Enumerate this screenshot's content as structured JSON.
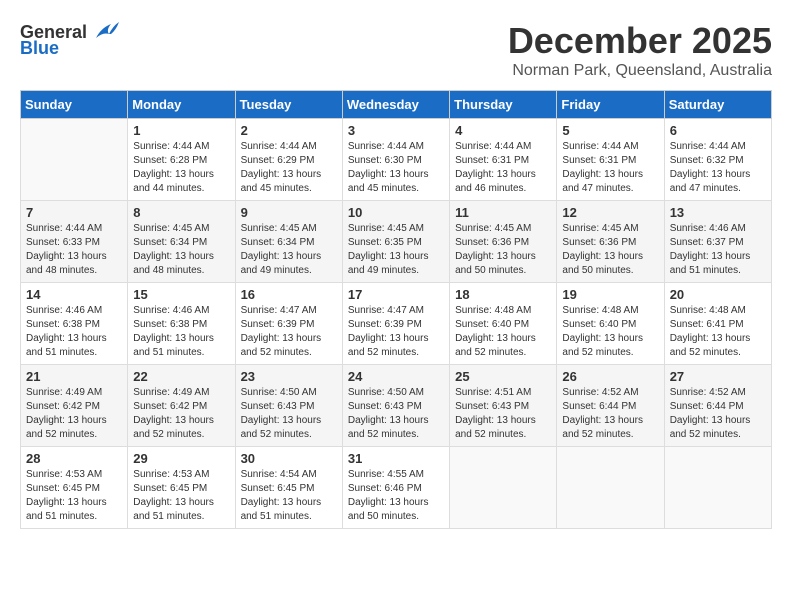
{
  "header": {
    "logo_general": "General",
    "logo_blue": "Blue",
    "month_title": "December 2025",
    "location": "Norman Park, Queensland, Australia"
  },
  "days_of_week": [
    "Sunday",
    "Monday",
    "Tuesday",
    "Wednesday",
    "Thursday",
    "Friday",
    "Saturday"
  ],
  "weeks": [
    [
      {
        "day": "",
        "sunrise": "",
        "sunset": "",
        "daylight": ""
      },
      {
        "day": "1",
        "sunrise": "Sunrise: 4:44 AM",
        "sunset": "Sunset: 6:28 PM",
        "daylight": "Daylight: 13 hours and 44 minutes."
      },
      {
        "day": "2",
        "sunrise": "Sunrise: 4:44 AM",
        "sunset": "Sunset: 6:29 PM",
        "daylight": "Daylight: 13 hours and 45 minutes."
      },
      {
        "day": "3",
        "sunrise": "Sunrise: 4:44 AM",
        "sunset": "Sunset: 6:30 PM",
        "daylight": "Daylight: 13 hours and 45 minutes."
      },
      {
        "day": "4",
        "sunrise": "Sunrise: 4:44 AM",
        "sunset": "Sunset: 6:31 PM",
        "daylight": "Daylight: 13 hours and 46 minutes."
      },
      {
        "day": "5",
        "sunrise": "Sunrise: 4:44 AM",
        "sunset": "Sunset: 6:31 PM",
        "daylight": "Daylight: 13 hours and 47 minutes."
      },
      {
        "day": "6",
        "sunrise": "Sunrise: 4:44 AM",
        "sunset": "Sunset: 6:32 PM",
        "daylight": "Daylight: 13 hours and 47 minutes."
      }
    ],
    [
      {
        "day": "7",
        "sunrise": "Sunrise: 4:44 AM",
        "sunset": "Sunset: 6:33 PM",
        "daylight": "Daylight: 13 hours and 48 minutes."
      },
      {
        "day": "8",
        "sunrise": "Sunrise: 4:45 AM",
        "sunset": "Sunset: 6:34 PM",
        "daylight": "Daylight: 13 hours and 48 minutes."
      },
      {
        "day": "9",
        "sunrise": "Sunrise: 4:45 AM",
        "sunset": "Sunset: 6:34 PM",
        "daylight": "Daylight: 13 hours and 49 minutes."
      },
      {
        "day": "10",
        "sunrise": "Sunrise: 4:45 AM",
        "sunset": "Sunset: 6:35 PM",
        "daylight": "Daylight: 13 hours and 49 minutes."
      },
      {
        "day": "11",
        "sunrise": "Sunrise: 4:45 AM",
        "sunset": "Sunset: 6:36 PM",
        "daylight": "Daylight: 13 hours and 50 minutes."
      },
      {
        "day": "12",
        "sunrise": "Sunrise: 4:45 AM",
        "sunset": "Sunset: 6:36 PM",
        "daylight": "Daylight: 13 hours and 50 minutes."
      },
      {
        "day": "13",
        "sunrise": "Sunrise: 4:46 AM",
        "sunset": "Sunset: 6:37 PM",
        "daylight": "Daylight: 13 hours and 51 minutes."
      }
    ],
    [
      {
        "day": "14",
        "sunrise": "Sunrise: 4:46 AM",
        "sunset": "Sunset: 6:38 PM",
        "daylight": "Daylight: 13 hours and 51 minutes."
      },
      {
        "day": "15",
        "sunrise": "Sunrise: 4:46 AM",
        "sunset": "Sunset: 6:38 PM",
        "daylight": "Daylight: 13 hours and 51 minutes."
      },
      {
        "day": "16",
        "sunrise": "Sunrise: 4:47 AM",
        "sunset": "Sunset: 6:39 PM",
        "daylight": "Daylight: 13 hours and 52 minutes."
      },
      {
        "day": "17",
        "sunrise": "Sunrise: 4:47 AM",
        "sunset": "Sunset: 6:39 PM",
        "daylight": "Daylight: 13 hours and 52 minutes."
      },
      {
        "day": "18",
        "sunrise": "Sunrise: 4:48 AM",
        "sunset": "Sunset: 6:40 PM",
        "daylight": "Daylight: 13 hours and 52 minutes."
      },
      {
        "day": "19",
        "sunrise": "Sunrise: 4:48 AM",
        "sunset": "Sunset: 6:40 PM",
        "daylight": "Daylight: 13 hours and 52 minutes."
      },
      {
        "day": "20",
        "sunrise": "Sunrise: 4:48 AM",
        "sunset": "Sunset: 6:41 PM",
        "daylight": "Daylight: 13 hours and 52 minutes."
      }
    ],
    [
      {
        "day": "21",
        "sunrise": "Sunrise: 4:49 AM",
        "sunset": "Sunset: 6:42 PM",
        "daylight": "Daylight: 13 hours and 52 minutes."
      },
      {
        "day": "22",
        "sunrise": "Sunrise: 4:49 AM",
        "sunset": "Sunset: 6:42 PM",
        "daylight": "Daylight: 13 hours and 52 minutes."
      },
      {
        "day": "23",
        "sunrise": "Sunrise: 4:50 AM",
        "sunset": "Sunset: 6:43 PM",
        "daylight": "Daylight: 13 hours and 52 minutes."
      },
      {
        "day": "24",
        "sunrise": "Sunrise: 4:50 AM",
        "sunset": "Sunset: 6:43 PM",
        "daylight": "Daylight: 13 hours and 52 minutes."
      },
      {
        "day": "25",
        "sunrise": "Sunrise: 4:51 AM",
        "sunset": "Sunset: 6:43 PM",
        "daylight": "Daylight: 13 hours and 52 minutes."
      },
      {
        "day": "26",
        "sunrise": "Sunrise: 4:52 AM",
        "sunset": "Sunset: 6:44 PM",
        "daylight": "Daylight: 13 hours and 52 minutes."
      },
      {
        "day": "27",
        "sunrise": "Sunrise: 4:52 AM",
        "sunset": "Sunset: 6:44 PM",
        "daylight": "Daylight: 13 hours and 52 minutes."
      }
    ],
    [
      {
        "day": "28",
        "sunrise": "Sunrise: 4:53 AM",
        "sunset": "Sunset: 6:45 PM",
        "daylight": "Daylight: 13 hours and 51 minutes."
      },
      {
        "day": "29",
        "sunrise": "Sunrise: 4:53 AM",
        "sunset": "Sunset: 6:45 PM",
        "daylight": "Daylight: 13 hours and 51 minutes."
      },
      {
        "day": "30",
        "sunrise": "Sunrise: 4:54 AM",
        "sunset": "Sunset: 6:45 PM",
        "daylight": "Daylight: 13 hours and 51 minutes."
      },
      {
        "day": "31",
        "sunrise": "Sunrise: 4:55 AM",
        "sunset": "Sunset: 6:46 PM",
        "daylight": "Daylight: 13 hours and 50 minutes."
      },
      {
        "day": "",
        "sunrise": "",
        "sunset": "",
        "daylight": ""
      },
      {
        "day": "",
        "sunrise": "",
        "sunset": "",
        "daylight": ""
      },
      {
        "day": "",
        "sunrise": "",
        "sunset": "",
        "daylight": ""
      }
    ]
  ]
}
